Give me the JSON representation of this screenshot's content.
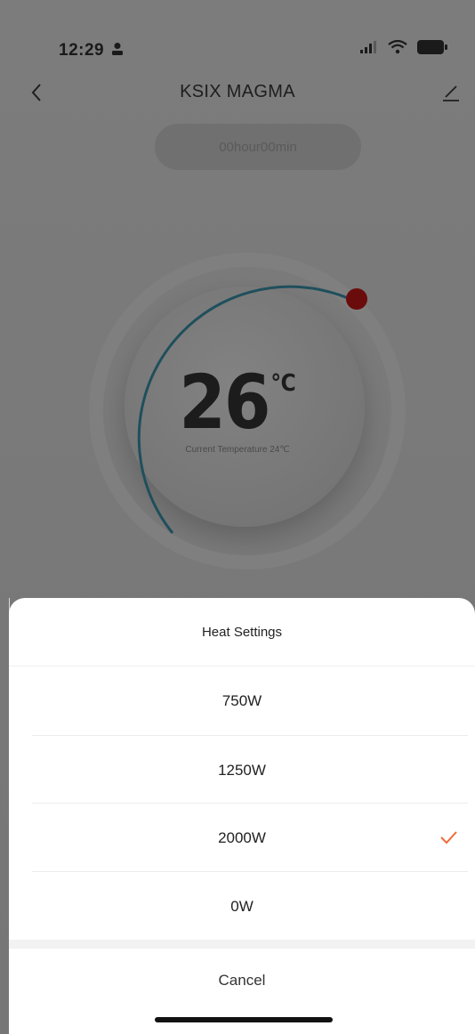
{
  "status_bar": {
    "time": "12:29",
    "icons": [
      "person-icon",
      "signal-icon",
      "wifi-icon",
      "battery-icon"
    ]
  },
  "nav": {
    "title": "KSIX MAGMA",
    "icons": [
      "chevron-left-icon",
      "edit-icon"
    ]
  },
  "timer": {
    "label": "00hour00min"
  },
  "thermostat": {
    "target_value": "26",
    "unit": "℃",
    "current_label": "Current Temperature 24℃",
    "arc_color": "#1f4f5c",
    "knob_color": "#6b0c0c",
    "icons": [
      "dial-knob-icon"
    ]
  },
  "sheet": {
    "title": "Heat Settings",
    "options": [
      {
        "label": "750W",
        "selected": false
      },
      {
        "label": "1250W",
        "selected": false
      },
      {
        "label": "2000W",
        "selected": true
      },
      {
        "label": "0W",
        "selected": false
      }
    ],
    "cancel_label": "Cancel",
    "check_color": "#f06a3c",
    "icons": [
      "check-icon"
    ]
  }
}
